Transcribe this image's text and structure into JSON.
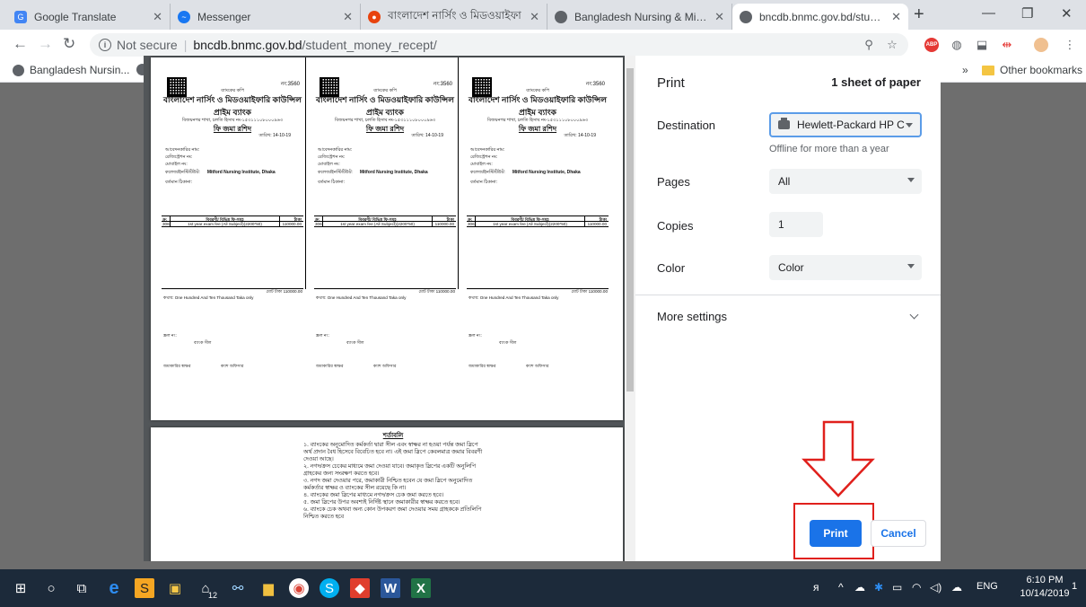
{
  "tabs": [
    {
      "title": "Google Translate",
      "color": "#4285f4",
      "glyph": "G"
    },
    {
      "title": "Messenger",
      "color": "#1877f2",
      "glyph": "m"
    },
    {
      "title": "বাংলাদেশ নার্সিং ও মিডওয়াইফা",
      "color": "#e8430e",
      "glyph": "●"
    },
    {
      "title": "Bangladesh Nursing & Midwife",
      "color": "#5f6368",
      "glyph": "◉"
    },
    {
      "title": "bncdb.bnmc.gov.bd/student_m",
      "color": "#5f6368",
      "glyph": "◉"
    }
  ],
  "toolbar": {
    "not_secure": "Not secure",
    "host": "bncdb.bnmc.gov.bd",
    "path": "/student_money_recept/"
  },
  "bookmarks": {
    "first": "Bangladesh Nursin...",
    "more": "»",
    "other": "Other bookmarks"
  },
  "receipt": {
    "no": "নং:3560",
    "line1": "ব্যাংকের কপি",
    "org": "বাংলাদেশ নার্সিং ও মিডওয়াইফারি কাউন্সিল",
    "bank": "প্রাইম ব্যাংক",
    "branch": "বিজয়নগর শাখা, চলতি হিসাব নং-১৫৩১১১০৮০০০৯৬৩",
    "slip": "ফি জমা রশিদ",
    "date": "তারিখ: 14-10-19",
    "name": "আবেদনকারির নাম:",
    "reg": "রেজিস্ট্রেশন নং:",
    "mobile": "মোবাইল নং:",
    "inst_label": "কলেজ/ইনস্টিটিউট:",
    "inst": "Mitford Nursing Institute, Dhaka",
    "address": "বর্তমান ঠিকানা:",
    "h_no": "ক্র:",
    "h_desc": "বিবরণী/ বিভিন্ন ফি-সমূহ",
    "h_amt": "টাকা",
    "r_no": "306",
    "r_desc": "1st year exam fee (All Subject)(2200*50)",
    "r_amt": "110000.00",
    "total": "মোট টাকা  110000.00",
    "words": "কথায়: One Hundred And Ten Thousand Taka only",
    "scroll": "স্ক্রল নং:",
    "seal": "ব্যাংক সীল",
    "sign1": "জমাকারির স্বাক্ষর",
    "sign2": "ক্যাশ অফিসার"
  },
  "terms": {
    "heading": "শর্তাবলি",
    "lines": [
      "১. ব্যাংকের অনুমোদিত কর্মকর্তা দ্বারা সীল এবং স্বাক্ষর না হওয়া পর্যন্ত জমা স্লিপে অর্থ প্রদান বৈধ হিসেবে বিবেচিত হবে না। এই জমা স্লিপে কেবলমাত্র জমার বিবরণী দেওয়া আছে।",
      "২. নগদ/ক্রস চেকের মাধ্যমে জমা দেওয়া যাবে। জমাকৃত স্লিপের একটি অনুলিপি গ্রাহকের জন্য সংরক্ষণ করতে হবে।",
      "৩. নগদ জমা দেওয়ার পরে, জমাকারী নিশ্চিত হবেন যে জমা স্লিপে অনুমোদিত কর্মকর্তার স্বাক্ষর ও ব্যাংকের সীল রয়েছে কি না।",
      "৪. ব্যাংকের জমা স্লিপের মাধ্যমে নগদ/ক্রস চেক জমা করতে হবে।",
      "৫. জমা স্লিপের উপর অবশ্যই নির্দিষ্ট স্থানে জমাকারীর স্বাক্ষর করতে হবে।",
      "৬. ব্যাংকে চেক অথবা অন্য কোন উপকরণ জমা দেওয়ার সময় গ্রাহককে প্রতিলিপি নিশ্চিত করতে হবে"
    ]
  },
  "print": {
    "title": "Print",
    "sheets": "1 sheet of paper",
    "destination_label": "Destination",
    "destination_value": "Hewlett-Packard HP C",
    "destination_status": "Offline for more than a year",
    "pages_label": "Pages",
    "pages_value": "All",
    "copies_label": "Copies",
    "copies_value": "1",
    "color_label": "Color",
    "color_value": "Color",
    "more_settings": "More settings",
    "print_button": "Print",
    "cancel_button": "Cancel"
  },
  "taskbar": {
    "badge": "12",
    "lang": "ENG",
    "time": "6:10 PM",
    "date": "10/14/2019",
    "notif": "1"
  }
}
